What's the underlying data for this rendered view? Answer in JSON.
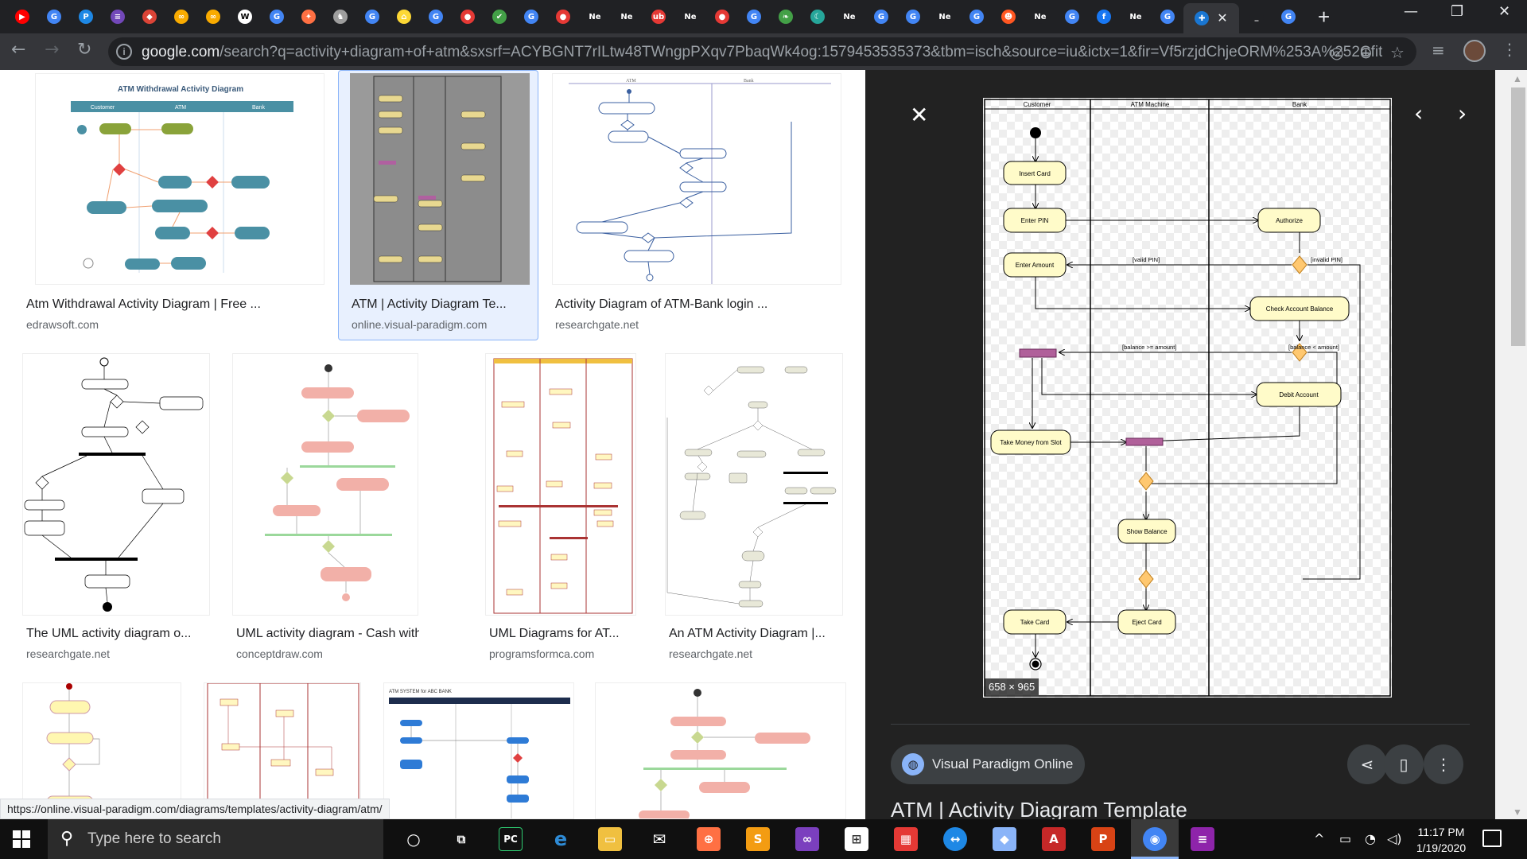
{
  "browser": {
    "tabs": [
      {
        "icon": "youtube-icon",
        "color": "#ff0000",
        "glyph": "▶"
      },
      {
        "icon": "google-icon",
        "color": "#4285f4",
        "glyph": "G"
      },
      {
        "icon": "pycharm-icon",
        "color": "#1e88e5",
        "glyph": "P"
      },
      {
        "icon": "forms-icon",
        "color": "#7248b9",
        "glyph": "≡"
      },
      {
        "icon": "diamond-icon",
        "color": "#db4437",
        "glyph": "◆"
      },
      {
        "icon": "colab-icon",
        "color": "#f9ab00",
        "glyph": "∞"
      },
      {
        "icon": "colab-icon",
        "color": "#f9ab00",
        "glyph": "∞"
      },
      {
        "icon": "wikipedia-icon",
        "color": "#ffffff",
        "glyph": "W"
      },
      {
        "icon": "google-icon",
        "color": "#4285f4",
        "glyph": "G"
      },
      {
        "icon": "orange-icon",
        "color": "#ff7043",
        "glyph": "✦"
      },
      {
        "icon": "chess-icon",
        "color": "#9e9e9e",
        "glyph": "♞"
      },
      {
        "icon": "google-icon",
        "color": "#4285f4",
        "glyph": "G"
      },
      {
        "icon": "house-icon",
        "color": "#fdd835",
        "glyph": "⌂"
      },
      {
        "icon": "google-icon",
        "color": "#4285f4",
        "glyph": "G"
      },
      {
        "icon": "ball-icon",
        "color": "#e53935",
        "glyph": "●"
      },
      {
        "icon": "check-icon",
        "color": "#43a047",
        "glyph": "✔"
      },
      {
        "icon": "google-icon",
        "color": "#4285f4",
        "glyph": "G"
      },
      {
        "icon": "ball-icon",
        "color": "#e53935",
        "glyph": "●"
      },
      {
        "icon": "netflix-text",
        "color": "#202124",
        "glyph": "Ne"
      },
      {
        "icon": "netflix-text",
        "color": "#202124",
        "glyph": "Ne"
      },
      {
        "icon": "ub-icon",
        "color": "#e53935",
        "glyph": "ub"
      },
      {
        "icon": "netflix-text",
        "color": "#202124",
        "glyph": "Ne"
      },
      {
        "icon": "ball-icon",
        "color": "#e53935",
        "glyph": "●"
      },
      {
        "icon": "google-icon",
        "color": "#4285f4",
        "glyph": "G"
      },
      {
        "icon": "leaf-icon",
        "color": "#43a047",
        "glyph": "❧"
      },
      {
        "icon": "swirl-icon",
        "color": "#26a69a",
        "glyph": "☾"
      },
      {
        "icon": "netflix-text",
        "color": "#202124",
        "glyph": "Ne"
      },
      {
        "icon": "google-icon",
        "color": "#4285f4",
        "glyph": "G"
      },
      {
        "icon": "google-icon",
        "color": "#4285f4",
        "glyph": "G"
      },
      {
        "icon": "netflix-text",
        "color": "#202124",
        "glyph": "Ne"
      },
      {
        "icon": "google-icon",
        "color": "#4285f4",
        "glyph": "G"
      },
      {
        "icon": "reddit-icon",
        "color": "#ff5722",
        "glyph": "☻"
      },
      {
        "icon": "netflix-text",
        "color": "#202124",
        "glyph": "Ne"
      },
      {
        "icon": "google-icon",
        "color": "#4285f4",
        "glyph": "G"
      },
      {
        "icon": "facebook-icon",
        "color": "#1877f2",
        "glyph": "f"
      },
      {
        "icon": "netflix-text",
        "color": "#202124",
        "glyph": "Ne"
      },
      {
        "icon": "google-icon",
        "color": "#4285f4",
        "glyph": "G"
      },
      {
        "icon": "visual-paradigm-icon",
        "color": "#1976d2",
        "glyph": "✚",
        "active": true
      },
      {
        "icon": "loading-icon",
        "color": "#202124",
        "glyph": "_"
      },
      {
        "icon": "google-icon",
        "color": "#4285f4",
        "glyph": "G"
      }
    ],
    "url_domain": "google.com",
    "url_rest": "/search?q=activity+diagram+of+atm&sxsrf=ACYBGNT7rILtw48TWngpPXqv7PbaqWk4og:1579453535373&tbm=isch&source=iu&ictx=1&fir=Vf5rzjdChjeORM%253A%252Cfit8A..."
  },
  "results": [
    {
      "title": "Atm Withdrawal Activity Diagram | Free ...",
      "source": "edrawsoft.com",
      "style": "edraw"
    },
    {
      "title": "ATM | Activity Diagram Te...",
      "source": "online.visual-paradigm.com",
      "style": "vp"
    },
    {
      "title": "Activity Diagram of ATM-Bank login ...",
      "source": "researchgate.net",
      "style": "rg1"
    },
    {
      "title": "The UML activity diagram o...",
      "source": "researchgate.net",
      "style": "uml1"
    },
    {
      "title": "UML activity diagram - Cash withd...",
      "source": "conceptdraw.com",
      "style": "cd"
    },
    {
      "title": "UML Diagrams for AT...",
      "source": "programsformca.com",
      "style": "pfm"
    },
    {
      "title": "An ATM Activity Diagram |...",
      "source": "researchgate.net",
      "style": "rg2"
    },
    {
      "title": "",
      "source": "",
      "style": "yellow"
    },
    {
      "title": "",
      "source": "",
      "style": "lanes"
    },
    {
      "title": "",
      "source": "",
      "style": "blue"
    },
    {
      "title": "",
      "source": "",
      "style": "cd2"
    }
  ],
  "thumbs": {
    "edraw_title": "ATM Withdrawal Activity Diagram",
    "edraw_lanes": [
      "Customer",
      "ATM",
      "Bank"
    ],
    "bank_lanes": [
      "ATM",
      "Bank"
    ],
    "abc_title": "ATM SYSTEM for ABC BANK"
  },
  "preview": {
    "diagram": {
      "lanes": [
        "Customer",
        "ATM Machine",
        "Bank"
      ],
      "nodes": {
        "insert_card": "Insert Card",
        "enter_pin": "Enter PIN",
        "authorize": "Authorize",
        "enter_amount": "Enter Amount",
        "check_balance": "Check Account Balance",
        "debit_account": "Debit Account",
        "take_money": "Take Money from Slot",
        "show_balance": "Show Balance",
        "take_card": "Take Card",
        "eject_card": "Eject Card"
      },
      "guards": {
        "valid_pin": "[valid PIN]",
        "invalid_pin": "[invalid PIN]",
        "balance_ge": "[balance >= amount]",
        "balance_lt": "[balance < amount]"
      }
    },
    "dimensions": "658 × 965",
    "source_label": "Visual Paradigm Online",
    "title": "ATM | Activity Diagram Template"
  },
  "status_link": "https://online.visual-paradigm.com/diagrams/templates/activity-diagram/atm/",
  "taskbar": {
    "search_placeholder": "Type here to search",
    "time": "11:17 PM",
    "date": "1/19/2020"
  }
}
